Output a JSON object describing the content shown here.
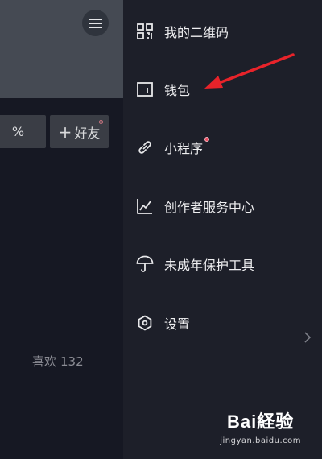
{
  "left": {
    "percent_button": "%",
    "add_friend_label": "好友",
    "add_friend_plus": "+",
    "likes_label": "喜欢",
    "likes_count": "132"
  },
  "drawer": {
    "items": [
      {
        "label": "我的二维码",
        "icon": "qr-code-icon"
      },
      {
        "label": "钱包",
        "icon": "wallet-icon"
      },
      {
        "label": "小程序",
        "icon": "link-icon",
        "has_badge": true
      },
      {
        "label": "创作者服务中心",
        "icon": "line-chart-icon"
      },
      {
        "label": "未成年保护工具",
        "icon": "umbrella-icon"
      },
      {
        "label": "设置",
        "icon": "settings-icon"
      }
    ]
  },
  "annotation": {
    "arrow_color": "#e8232a",
    "points_to": "钱包"
  },
  "watermark": {
    "logo": "Bai経验",
    "url": "jingyan.baidu.com"
  },
  "colors": {
    "drawer_bg": "#1d1f29",
    "page_bg": "#161823",
    "badge": "#f0495e"
  }
}
